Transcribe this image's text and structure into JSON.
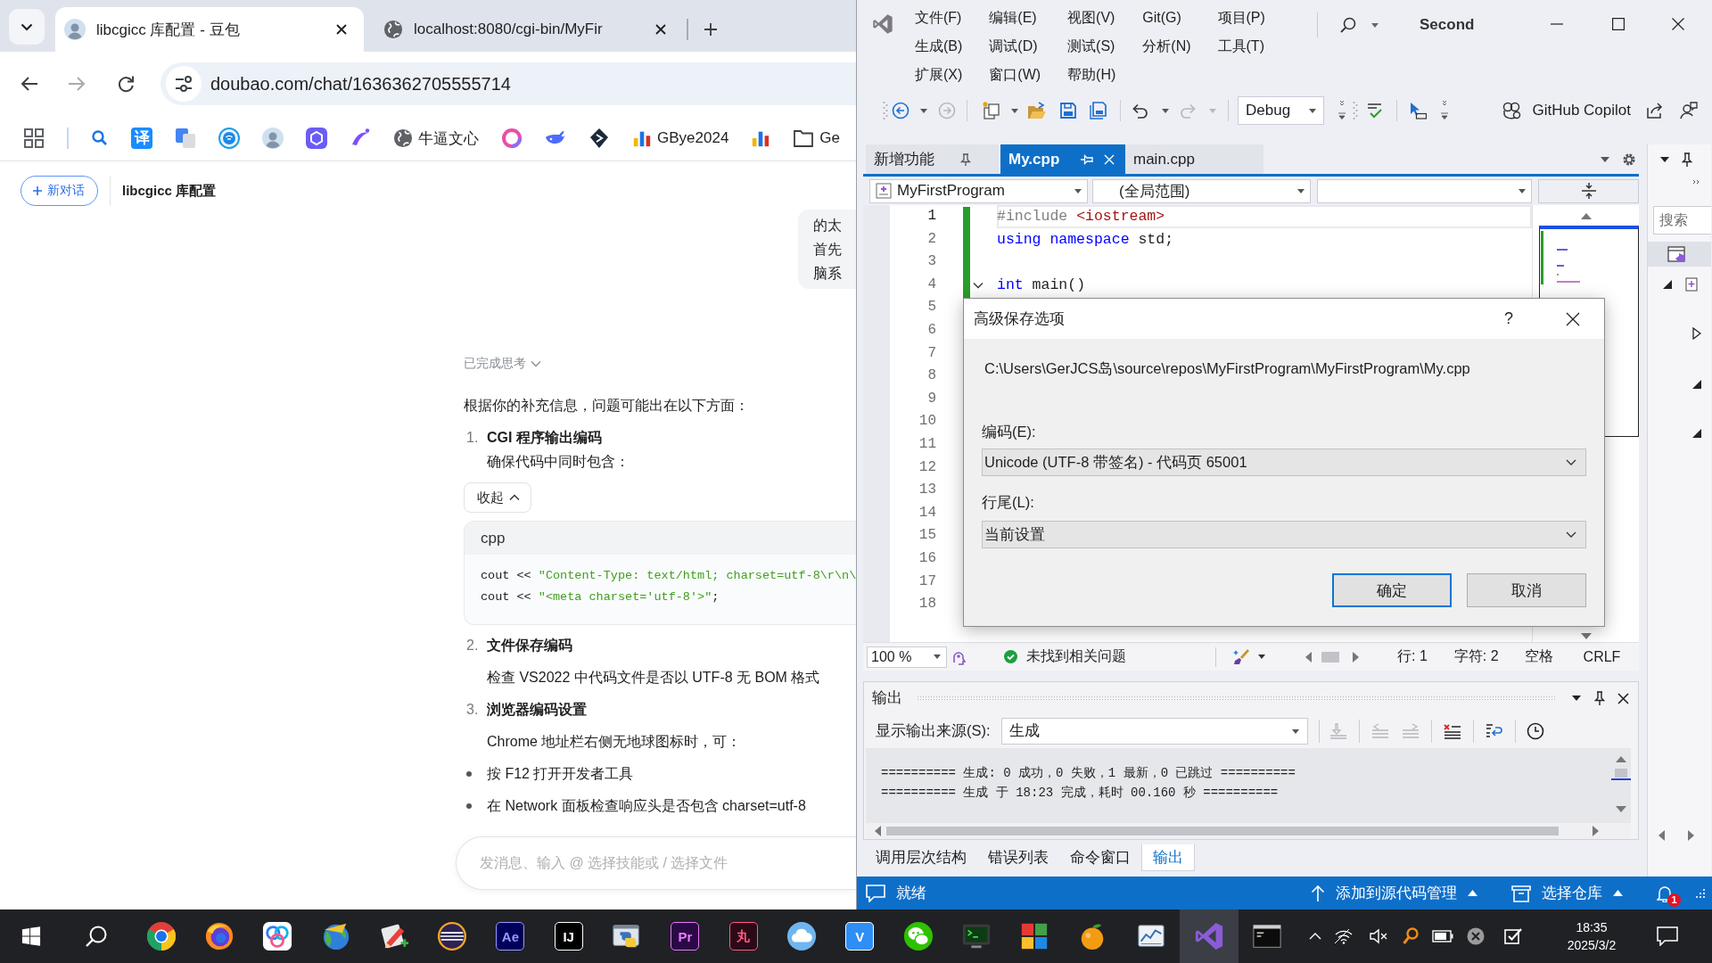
{
  "browser": {
    "tabs": [
      {
        "title": "libcgicc 库配置 - 豆包",
        "selected": true
      },
      {
        "title": "localhost:8080/cgi-bin/MyFir",
        "selected": false
      }
    ],
    "address": "doubao.com/chat/1636362705555714",
    "bookmark_glyph": "译",
    "bookmarks": [
      "牛逼文心",
      "GBye2024",
      "Ge"
    ]
  },
  "chat": {
    "new_chat": "新对话",
    "title": "libcgicc 库配置",
    "user_message": [
      "的太",
      "首先",
      "脑系"
    ],
    "thinking": "已完成思考",
    "intro": "根据你的补充信息，问题可能出在以下方面：",
    "sections": [
      {
        "number": "1.",
        "title": "CGI 程序输出编码",
        "text": "确保代码中同时包含：",
        "collapse": "收起",
        "code": {
          "language": "cpp",
          "lines": [
            [
              {
                "kind": "plain",
                "text": "cout << "
              },
              {
                "kind": "string",
                "text": "\"Content-Type: text/html; charset=utf-8\\r\\n\\"
              }
            ],
            [
              {
                "kind": "plain",
                "text": "cout << "
              },
              {
                "kind": "string",
                "text": "\"<meta charset='utf-8'>\""
              },
              {
                "kind": "plain",
                "text": ";"
              }
            ]
          ]
        }
      },
      {
        "number": "2.",
        "title": "文件保存编码",
        "text": "检查 VS2022 中代码文件是否以 UTF-8 无 BOM 格式"
      },
      {
        "number": "3.",
        "title": "浏览器编码设置",
        "text": "Chrome 地址栏右侧无地球图标时，可："
      }
    ],
    "bullets": [
      "按 F12 打开开发者工具",
      "在 Network 面板检查响应头是否包含 charset=utf-8"
    ],
    "input_placeholder": "发消息、输入 @ 选择技能或 / 选择文件"
  },
  "vs": {
    "menu": [
      "文件(F)",
      "编辑(E)",
      "视图(V)",
      "Git(G)",
      "项目(P)",
      "生成(B)",
      "调试(D)",
      "测试(S)",
      "分析(N)",
      "工具(T)",
      "扩展(X)",
      "窗口(W)",
      "帮助(H)"
    ],
    "solution": "Second",
    "configuration": "Debug",
    "copilot": "GitHub Copilot",
    "doc_tabs": [
      {
        "label": "新增功能",
        "selected": false,
        "pinned": true
      },
      {
        "label": "My.cpp",
        "selected": true,
        "pinned": false
      },
      {
        "label": "main.cpp",
        "selected": false,
        "pinned": false
      }
    ],
    "navigation": {
      "project": "MyFirstProgram",
      "scope": "(全局范围)"
    },
    "editor": {
      "lines": [
        {
          "number": "1",
          "current": true,
          "foldable": false,
          "tokens": [
            {
              "kind": "preproc",
              "text": "#include "
            },
            {
              "kind": "include",
              "text": "<iostream>"
            }
          ]
        },
        {
          "number": "2",
          "current": false,
          "foldable": false,
          "tokens": [
            {
              "kind": "keyword",
              "text": "using"
            },
            {
              "kind": "keyword",
              "text": " namespace"
            },
            {
              "kind": "plain",
              "text": " std;"
            }
          ]
        },
        {
          "number": "3",
          "current": false,
          "foldable": false
        },
        {
          "number": "4",
          "current": false,
          "foldable": true,
          "tokens": [
            {
              "kind": "keyword",
              "text": "int"
            },
            {
              "kind": "plain",
              "text": " main()"
            }
          ]
        },
        {
          "number": "5",
          "current": false,
          "foldable": false
        },
        {
          "number": "6",
          "current": false,
          "foldable": false
        },
        {
          "number": "7",
          "current": false,
          "foldable": false
        },
        {
          "number": "8",
          "current": false,
          "foldable": false
        },
        {
          "number": "9",
          "current": false,
          "foldable": false
        },
        {
          "number": "10",
          "current": false,
          "foldable": false
        },
        {
          "number": "11",
          "current": false,
          "foldable": false
        },
        {
          "number": "12",
          "current": false,
          "foldable": false
        },
        {
          "number": "13",
          "current": false,
          "foldable": false
        },
        {
          "number": "14",
          "current": false,
          "foldable": false
        },
        {
          "number": "15",
          "current": false,
          "foldable": false
        },
        {
          "number": "16",
          "current": false,
          "foldable": false
        },
        {
          "number": "17",
          "current": false,
          "foldable": false
        },
        {
          "number": "18",
          "current": false,
          "foldable": false
        }
      ]
    },
    "dialog": {
      "title": "高级保存选项",
      "help": "?",
      "path": "C:\\Users\\GerJCS岛\\source\\repos\\MyFirstProgram\\MyFirstProgram\\My.cpp",
      "encoding_label": "编码(E):",
      "encoding": "Unicode (UTF-8 带签名) - 代码页 65001",
      "line_ending_label": "行尾(L):",
      "line_ending": "当前设置",
      "buttons": [
        {
          "label": "确定",
          "default": true
        },
        {
          "label": "取消",
          "default": false
        }
      ]
    },
    "editor_status": {
      "zoom": "100 %",
      "issues": "未找到相关问题",
      "line": "行: 1",
      "column": "字符: 2",
      "indent": "空格",
      "line_ending": "CRLF"
    },
    "output": {
      "title": "输出",
      "source_label": "显示输出来源(S):",
      "source": "生成",
      "lines": [
        "========== 生成: 0 成功，0 失败，1 最新，0 已跳过 ==========",
        "========== 生成 于 18:23 完成，耗时 00.160 秒 =========="
      ]
    },
    "tool_tabs": [
      {
        "label": "调用层次结构",
        "selected": false
      },
      {
        "label": "错误列表",
        "selected": false
      },
      {
        "label": "命令窗口",
        "selected": false
      },
      {
        "label": "输出",
        "selected": true
      }
    ],
    "side_panel": {
      "search_placeholder": "搜索"
    },
    "status_bar": {
      "text": "就绪",
      "source_control": "添加到源代码管理",
      "repository": "选择仓库",
      "notifications": "1"
    }
  },
  "taskbar": {
    "apps": [
      {
        "kind": "icon",
        "selected": false
      },
      {
        "kind": "icon",
        "selected": false
      },
      {
        "kind": "icon",
        "selected": false
      },
      {
        "kind": "icon",
        "selected": false
      },
      {
        "kind": "icon",
        "selected": false
      },
      {
        "kind": "icon",
        "selected": false
      },
      {
        "kind": "letters",
        "label": "Ae",
        "color": "#00005b",
        "selected": false
      },
      {
        "kind": "letters",
        "label": "IJ",
        "color": "#000000",
        "selected": false
      },
      {
        "kind": "icon",
        "selected": false
      },
      {
        "kind": "letters",
        "label": "Pr",
        "color": "#2a0a45",
        "selected": false
      },
      {
        "kind": "letters",
        "label": "丸",
        "color": "#2b0a17",
        "selected": false
      },
      {
        "kind": "icon",
        "selected": false
      },
      {
        "kind": "letters",
        "label": "V",
        "color": "#2f8ef4",
        "selected": false
      },
      {
        "kind": "icon",
        "selected": false
      },
      {
        "kind": "icon",
        "selected": false
      },
      {
        "kind": "icon",
        "selected": false
      },
      {
        "kind": "icon",
        "selected": false
      },
      {
        "kind": "icon",
        "selected": false
      },
      {
        "kind": "icon",
        "selected": true
      },
      {
        "kind": "icon",
        "selected": false
      }
    ],
    "time": "18:35",
    "date": "2025/3/2"
  }
}
